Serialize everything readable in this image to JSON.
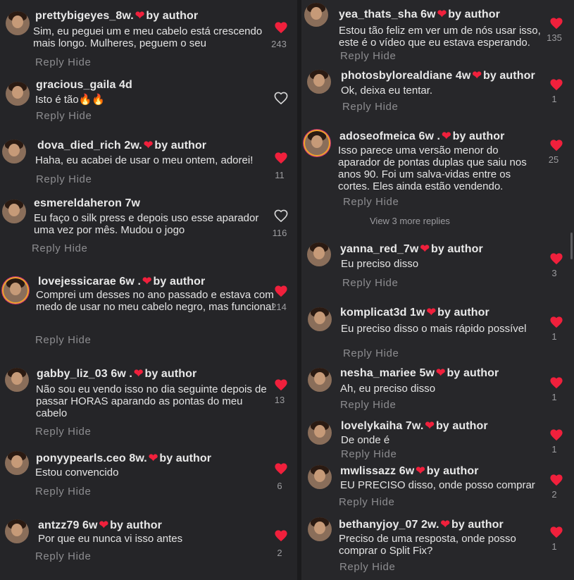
{
  "ui": {
    "reply_label": "Reply",
    "hide_label": "Hide"
  },
  "left_comments": [
    {
      "user": "prettybigeyes_8w.",
      "by_author": "by author",
      "text": "Sim, eu peguei um e meu cabelo está crescendo mais longo. Mulheres, peguem o seu",
      "likes": "243",
      "liked": true
    },
    {
      "user": "gracious_gaila 4d",
      "by_author": "",
      "text": "Isto é tão🔥🔥",
      "likes": "",
      "liked": false
    },
    {
      "user": "dova_died_rich 2w.",
      "by_author": "by author",
      "text": "Haha, eu acabei de usar o meu ontem, adorei!",
      "likes": "11",
      "liked": true
    },
    {
      "user": "esmereldaheron 7w",
      "by_author": "",
      "text": "Eu faço o silk press e depois uso esse aparador uma vez por mês. Mudou o jogo",
      "likes": "116",
      "liked": false
    },
    {
      "user": "lovejessicarae 6w .",
      "by_author": "by author",
      "text": "Comprei um desses no ano passado e estava com medo de usar no meu cabelo negro, mas funciona!",
      "likes": "214",
      "liked": true
    },
    {
      "user": "gabby_liz_03 6w .",
      "by_author": "by author",
      "text": "Não sou eu vendo isso no dia seguinte depois de passar HORAS aparando as pontas do meu cabelo",
      "likes": "13",
      "liked": true
    },
    {
      "user": "ponyypearls.ceo 8w.",
      "by_author": "by author",
      "text": "Estou convencido",
      "likes": "6",
      "liked": true
    },
    {
      "user": "antzz79 6w",
      "by_author": "by author",
      "text": "Por que eu nunca vi isso antes",
      "likes": "2",
      "liked": true
    }
  ],
  "right_comments": [
    {
      "user": "yea_thats_sha 6w",
      "by_author": "by author",
      "text": "Estou tão feliz em ver um de nós usar isso, este é o vídeo que eu estava esperando.",
      "likes": "135",
      "liked": true
    },
    {
      "user": "photosbylorealdiane 4w",
      "by_author": "by author",
      "text": "Ok, deixa eu tentar.",
      "likes": "1",
      "liked": true
    },
    {
      "user": "adoseofmeica 6w .",
      "by_author": "by author",
      "text": "Isso parece uma versão menor do aparador de pontas duplas que saiu nos anos 90. Foi um salva-vidas entre os cortes. Eles ainda estão vendendo.",
      "likes": "25",
      "liked": true
    },
    {
      "user": "yanna_red_7w",
      "by_author": "by author",
      "text": "Eu preciso disso",
      "likes": "3",
      "liked": true
    },
    {
      "user": "komplicat3d 1w",
      "by_author": "by author",
      "text": "Eu preciso disso o mais rápido possível",
      "likes": "1",
      "liked": true
    },
    {
      "user": "nesha_mariee 5w",
      "by_author": "by author",
      "text": "Ah, eu preciso disso",
      "likes": "1",
      "liked": true
    },
    {
      "user": "lovelykaiha 7w.",
      "by_author": "by author",
      "text": "De onde é",
      "likes": "1",
      "liked": true
    },
    {
      "user": "mwlissazz 6w",
      "by_author": "by author",
      "text": "EU PRECISO disso, onde posso comprar",
      "likes": "2",
      "liked": true
    },
    {
      "user": "bethanyjoy_07 2w.",
      "by_author": "by author",
      "text": "Preciso de uma resposta, onde posso comprar o Split Fix?",
      "likes": "1",
      "liked": true
    }
  ],
  "view_more": "View 3 more replies",
  "colors": {
    "heart": "#f0203c",
    "background": "#262629",
    "muted": "#8d8d90"
  }
}
